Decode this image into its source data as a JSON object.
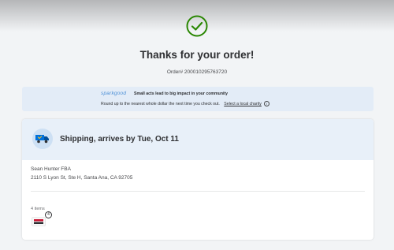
{
  "confirmation": {
    "title": "Thanks for your order!",
    "order_number": "Order# 200010295763720"
  },
  "sparkgood": {
    "logo_text": "sparkgood",
    "headline": "Small acts lead to big impact in your community",
    "subtext": "Round up to the nearest whole dollar the next time you check out.",
    "link_label": "Select a local charity",
    "info_icon": "info-icon"
  },
  "shipping": {
    "title": "Shipping, arrives by Tue, Oct 11",
    "recipient": "Sean Hunter FBA",
    "address": "2110 S Lyon St, Ste H, Santa Ana, CA 92705",
    "items_label": "4 items",
    "quantity_badge": "4"
  },
  "colors": {
    "success_green": "#2a8703",
    "spark_blue": "#4b8fd6",
    "card_header_bg": "#e8f0f9"
  }
}
